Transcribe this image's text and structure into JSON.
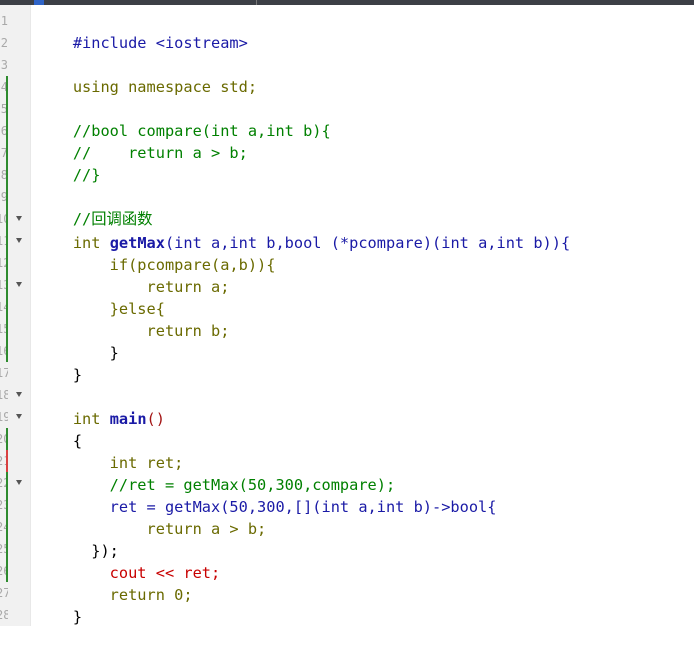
{
  "editor": {
    "line_numbers": [
      "1",
      "2",
      "3",
      "4",
      "5",
      "6",
      "7",
      "8",
      "9",
      "10",
      "11",
      "12",
      "13",
      "14",
      "15",
      "16",
      "17",
      "18",
      "19",
      "20",
      "21",
      "22",
      "23",
      "24",
      "25",
      "26",
      "27",
      "28"
    ],
    "code_lines": [
      [
        "#include <iostream>"
      ],
      [],
      [
        "using namespace std;"
      ],
      [],
      [
        "//bool compare(int a,int b){"
      ],
      [
        "//    return a > b;"
      ],
      [
        "//}"
      ],
      [],
      [
        "//回调函数"
      ],
      [
        "int ",
        "getMax",
        "(int a,int b,bool (*pcompare)(int a,int b)){"
      ],
      [
        "    if(pcompare(a,b)){"
      ],
      [
        "        return a;"
      ],
      [
        "    }else{"
      ],
      [
        "        return b;"
      ],
      [
        "    }"
      ],
      [
        "}"
      ],
      [],
      [
        "int ",
        "main",
        "()"
      ],
      [
        "{"
      ],
      [
        "    int ret;"
      ],
      [
        "    //ret = getMax(50,300,compare);"
      ],
      [
        "    ret = getMax(50,300,[](int a,int b)->bool{"
      ],
      [
        "        return a > b;"
      ],
      [
        "  });"
      ],
      [
        "    cout << ret;"
      ],
      [
        "    return 0;"
      ],
      [
        "}"
      ],
      []
    ]
  },
  "colors": {
    "keyword": "#6a6a00",
    "identifier": "#1a1aa6",
    "comment": "#008000",
    "punct": "#a31515",
    "cout": "#c80000",
    "modified_marker": "#2e8b2e",
    "changed_marker": "#d94040"
  }
}
